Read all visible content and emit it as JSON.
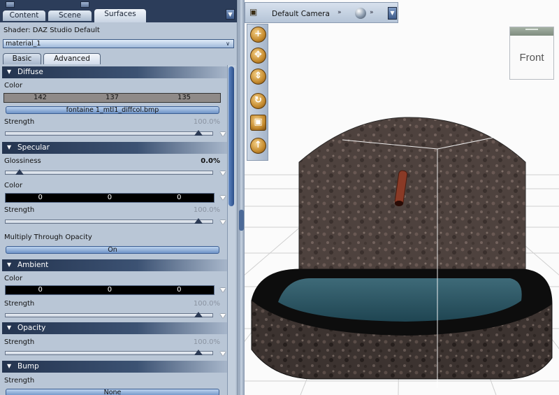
{
  "tabs": [
    "Content",
    "Scene",
    "Surfaces"
  ],
  "shader_label": "Shader: DAZ Studio Default",
  "material_select": "material_1",
  "subtabs": [
    "Basic",
    "Advanced"
  ],
  "diffuse": {
    "title": "Diffuse",
    "color_label": "Color",
    "rgb": [
      "142",
      "137",
      "135"
    ],
    "texture": "fontaine 1_mtl1_diffcol.bmp",
    "strength_label": "Strength",
    "strength": "100.0%",
    "strength_value": 1.0
  },
  "specular": {
    "title": "Specular",
    "glossiness_label": "Glossiness",
    "glossiness": "0.0%",
    "glossiness_value": 0.0,
    "color_label": "Color",
    "rgb": [
      "0",
      "0",
      "0"
    ],
    "strength_label": "Strength",
    "strength": "100.0%",
    "strength_value": 1.0
  },
  "multiply": {
    "label": "Multiply Through Opacity",
    "value": "On"
  },
  "ambient": {
    "title": "Ambient",
    "color_label": "Color",
    "rgb": [
      "0",
      "0",
      "0"
    ],
    "strength_label": "Strength",
    "strength": "100.0%",
    "strength_value": 1.0
  },
  "opacity": {
    "title": "Opacity",
    "strength_label": "Strength",
    "strength": "100.0%",
    "strength_value": 1.0
  },
  "bump": {
    "title": "Bump",
    "strength_label": "Strength",
    "map": "None"
  },
  "viewport": {
    "camera": "Default Camera",
    "view_cube_label": "Front"
  },
  "icons": {
    "camera": "camera-icon",
    "shading": "shading-sphere-icon",
    "nav": [
      "zoom-icon",
      "pan-icon",
      "dolly-icon",
      "orbit-icon",
      "frame-icon",
      "home-icon"
    ]
  }
}
